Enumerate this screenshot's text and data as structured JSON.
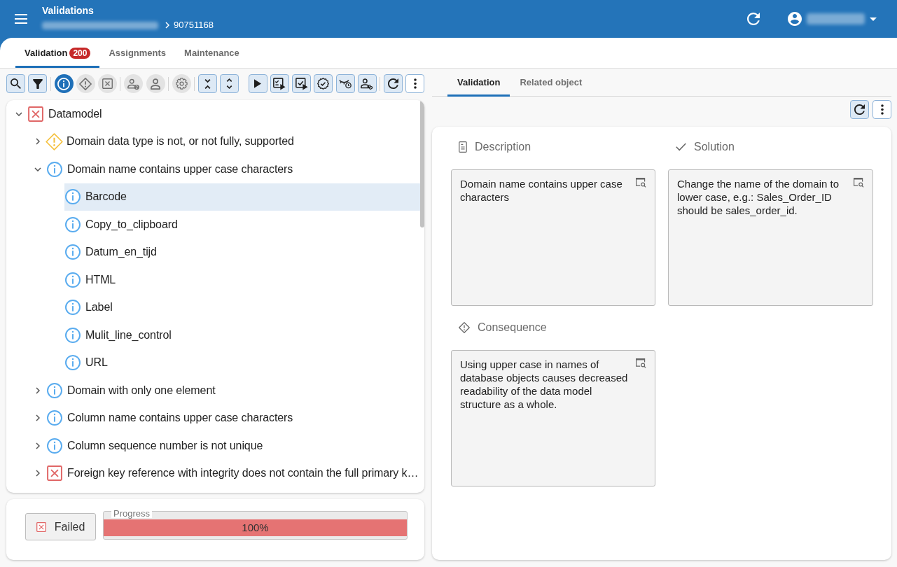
{
  "header": {
    "title": "Validations",
    "breadcrumb": "90751168"
  },
  "main_tabs": [
    {
      "label": "Validation",
      "badge": "200",
      "selected": true
    },
    {
      "label": "Assignments",
      "selected": false
    },
    {
      "label": "Maintenance",
      "selected": false
    }
  ],
  "toolbar": [
    {
      "kind": "button"
    },
    {
      "kind": "button"
    },
    {
      "kind": "separator"
    },
    {
      "kind": "toggle",
      "on": true
    },
    {
      "kind": "toggle",
      "on": false
    },
    {
      "kind": "toggle",
      "on": false
    },
    {
      "kind": "separator"
    },
    {
      "kind": "toggle",
      "on": false
    },
    {
      "kind": "toggle",
      "on": false
    },
    {
      "kind": "separator"
    },
    {
      "kind": "toggle",
      "on": false
    },
    {
      "kind": "separator"
    },
    {
      "kind": "button"
    },
    {
      "kind": "button"
    },
    {
      "kind": "spacer"
    },
    {
      "kind": "button"
    },
    {
      "kind": "button"
    },
    {
      "kind": "button"
    },
    {
      "kind": "button"
    },
    {
      "kind": "button"
    },
    {
      "kind": "button"
    },
    {
      "kind": "separator"
    },
    {
      "kind": "button"
    },
    {
      "kind": "menu"
    }
  ],
  "tree": [
    {
      "label": "Datamodel",
      "kind": "error",
      "expanded": true,
      "selected": false,
      "children": [
        {
          "label": "Domain data type is not, or not fully, supported",
          "kind": "warning",
          "expanded": false,
          "selected": false
        },
        {
          "label": "Domain name contains upper case characters",
          "kind": "info",
          "expanded": true,
          "selected": false,
          "children": [
            {
              "label": "Barcode",
              "kind": "info",
              "selected": true
            },
            {
              "label": "Copy_to_clipboard",
              "kind": "info",
              "selected": false
            },
            {
              "label": "Datum_en_tijd",
              "kind": "info",
              "selected": false
            },
            {
              "label": "HTML",
              "kind": "info",
              "selected": false
            },
            {
              "label": "Label",
              "kind": "info",
              "selected": false
            },
            {
              "label": "Mulit_line_control",
              "kind": "info",
              "selected": false
            },
            {
              "label": "URL",
              "kind": "info",
              "selected": false
            }
          ]
        },
        {
          "label": "Domain with only one element",
          "kind": "info",
          "expanded": false,
          "selected": false
        },
        {
          "label": "Column name contains upper case characters",
          "kind": "info",
          "expanded": false,
          "selected": false
        },
        {
          "label": "Column sequence number is not unique",
          "kind": "info",
          "expanded": false,
          "selected": false
        },
        {
          "label": "Foreign key reference with integrity does not contain the full primary k…",
          "kind": "error",
          "expanded": false,
          "selected": false
        }
      ]
    }
  ],
  "result": {
    "label": "Failed",
    "kind": "error"
  },
  "progress": {
    "legend": "Progress",
    "level": 1,
    "reading": "100%"
  },
  "detail_tabs": [
    {
      "label": "Validation",
      "selected": true
    },
    {
      "label": "Related object",
      "selected": false
    }
  ],
  "detail_toolbar": [
    {
      "kind": "button"
    },
    {
      "kind": "menu"
    }
  ],
  "sections": [
    {
      "kind": "description",
      "heading": "Description",
      "text": "Domain name contains upper case characters"
    },
    {
      "kind": "solution",
      "heading": "Solution",
      "text": "Change the name of the domain to lower case, e.g.: Sales_Order_ID should be sales_order_id."
    },
    {
      "kind": "consequence",
      "heading": "Consequence",
      "text": "Using upper case in names of database objects causes decreased readability of the data model structure as a whole."
    }
  ]
}
